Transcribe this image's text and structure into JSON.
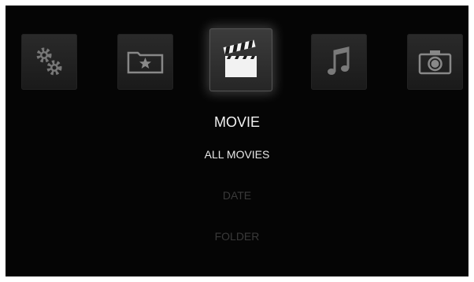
{
  "nav": {
    "items": [
      {
        "icon": "settings-gears-icon"
      },
      {
        "icon": "favorites-folder-icon"
      },
      {
        "icon": "movie-clapperboard-icon",
        "active": true
      },
      {
        "icon": "music-note-icon"
      },
      {
        "icon": "camera-icon"
      }
    ]
  },
  "section": {
    "title": "MOVIE",
    "menu": [
      "ALL MOVIES",
      "DATE",
      "FOLDER"
    ]
  },
  "colors": {
    "background": "#050505",
    "tile": "#222222",
    "text_selected": "#e8e8e8",
    "text_dim": "#3a3a3a"
  }
}
